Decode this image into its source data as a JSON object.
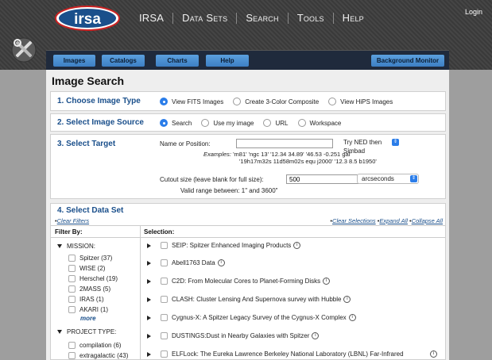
{
  "header": {
    "logo_text": "irsa",
    "nav": [
      "IRSA",
      "Data Sets",
      "Search",
      "Tools",
      "Help"
    ],
    "login": "Login"
  },
  "tabs": [
    "Images",
    "Catalogs",
    "Charts",
    "Help",
    "Background Monitor"
  ],
  "page_title": "Image Search",
  "sections": {
    "choose_type": {
      "title": "1. Choose Image Type",
      "options": [
        "View FITS Images",
        "Create 3-Color Composite",
        "View HiPS Images"
      ],
      "selected": 0
    },
    "source": {
      "title": "2. Select Image Source",
      "options": [
        "Search",
        "Use my image",
        "URL",
        "Workspace"
      ],
      "selected": 0
    },
    "target": {
      "title": "3. Select Target",
      "name_label": "Name or Position:",
      "name_value": "",
      "resolver": "Try NED then Simbad",
      "examples_label": "Examples:",
      "examples_line1": "'m81'    'ngc 13'    '12.34 34.89'    '46.53 -0.251 gal'",
      "examples_line2": "'19h17m32s 11d58m02s equ j2000'  '12.3 8.5 b1950'",
      "cutout_label": "Cutout size (leave blank for full size):",
      "cutout_value": "500",
      "cutout_unit": "arcseconds",
      "valid_range": "Valid range between: 1\" and 3600\""
    },
    "dataset": {
      "title": "4. Select Data Set",
      "clear_filters": "Clear Filters",
      "clear_selections": "Clear Selections",
      "expand_all": "Expand All",
      "collapse_all": "Collapse All",
      "filter_by": "Filter By:",
      "selection": "Selection:",
      "mission_label": "MISSION:",
      "missions": [
        "Spitzer (37)",
        "WISE (2)",
        "Herschel (19)",
        "2MASS (5)",
        "IRAS (1)",
        "AKARI (1)"
      ],
      "more": "more",
      "project_label": "PROJECT TYPE:",
      "projects": [
        "compilation (6)",
        "extragalactic (43)"
      ],
      "items": [
        "SEIP: Spitzer Enhanced Imaging Products",
        "Abell1763 Data",
        "C2D: From Molecular Cores to Planet-Forming Disks",
        "CLASH: Cluster Lensing And Supernova survey with Hubble",
        "Cygnus-X: A Spitzer Legacy Survey of the Cygnus-X Complex",
        "DUSTINGS:Dust in Nearby Galaxies with Spitzer",
        "ELFLock: The Eureka Lawrence Berkeley National Laboratory (LBNL) Far-Infrared Lockman Hole Map"
      ],
      "info_glyph": "i"
    }
  },
  "colors": {
    "accent": "#2b7de9",
    "section_title": "#1a4f8b",
    "tab": "#4a8fd4",
    "header_bg": "#3d3d3d"
  },
  "icons": [
    "tools-icon",
    "radio-icon",
    "checkbox-icon",
    "info-icon",
    "expand-triangle-icon"
  ]
}
